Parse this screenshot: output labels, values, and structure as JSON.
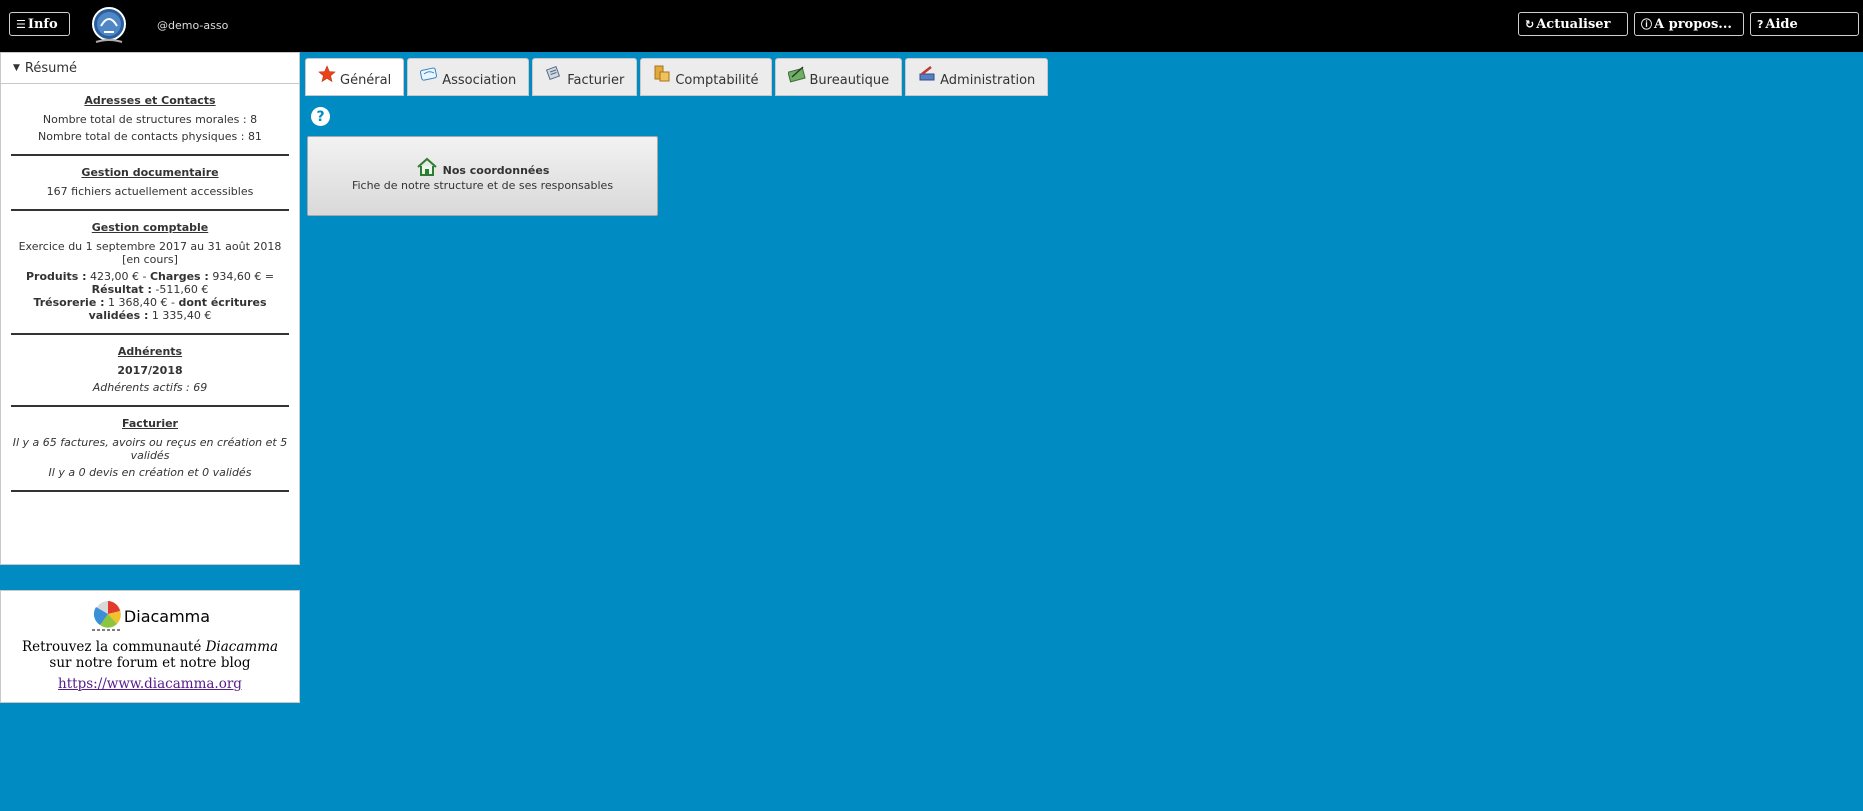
{
  "topbar": {
    "info_label": "Info",
    "instance": "@demo-asso",
    "refresh_label": "Actualiser",
    "about_label": "A propos...",
    "help_label": "Aide"
  },
  "summary": {
    "title": "Résumé",
    "contacts": {
      "title": "Adresses et Contacts",
      "line1": "Nombre total de structures morales : 8",
      "line2": "Nombre total de contacts physiques : 81"
    },
    "documents": {
      "title": "Gestion documentaire",
      "line1": "167 fichiers actuellement accessibles"
    },
    "accounting": {
      "title": "Gestion comptable",
      "exercise": "Exercice du 1 septembre 2017 au 31 août 2018 [en cours]",
      "produits_label": "Produits :",
      "produits_value": "423,00 €",
      "charges_label": "Charges :",
      "charges_value": "934,60 €",
      "resultat_label": "Résultat :",
      "resultat_value": "-511,60 €",
      "tresorerie_label": "Trésorerie :",
      "tresorerie_value": "1 368,40 €",
      "validees_label": "dont écritures validées :",
      "validees_value": "1 335,40 €"
    },
    "members": {
      "title": "Adhérents",
      "season": "2017/2018",
      "active": "Adhérents actifs : 69"
    },
    "invoicing": {
      "title": "Facturier",
      "line1": "Il y a 65 factures, avoirs ou reçus en création et 5 validés",
      "line2": "Il y a 0 devis en création et 0 validés"
    }
  },
  "promo": {
    "name": "Diacamma",
    "text_before": "Retrouvez la communauté",
    "text_brand": "Diacamma",
    "text_after": "sur notre forum et notre blog",
    "link": "https://www.diacamma.org"
  },
  "tabs": [
    {
      "label": "Général",
      "icon": "star-icon"
    },
    {
      "label": "Association",
      "icon": "association-icon"
    },
    {
      "label": "Facturier",
      "icon": "invoice-icon"
    },
    {
      "label": "Comptabilité",
      "icon": "coins-icon"
    },
    {
      "label": "Bureautique",
      "icon": "office-icon"
    },
    {
      "label": "Administration",
      "icon": "admin-icon"
    }
  ],
  "card": {
    "title": "Nos coordonnées",
    "subtitle": "Fiche de notre structure et de ses responsables",
    "icon": "home-icon"
  },
  "colors": {
    "background": "#008bc2",
    "topbar": "#000000"
  }
}
